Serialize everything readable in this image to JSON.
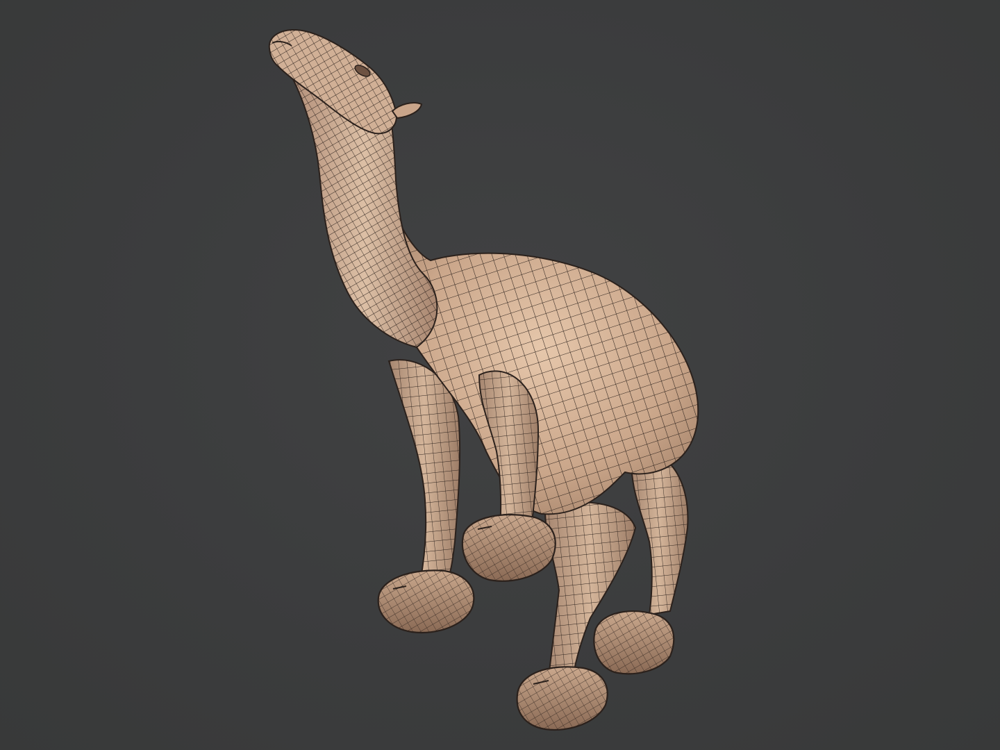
{
  "viewport": {
    "background_color": "#3c3d3e",
    "render_mode": "wireframe-on-shaded"
  },
  "model": {
    "subject": "camel",
    "surface_color": "#c9a58a",
    "shadow_color": "#8a6a55",
    "wire_color": "#2b211c",
    "icon": "camel-mesh-icon"
  }
}
